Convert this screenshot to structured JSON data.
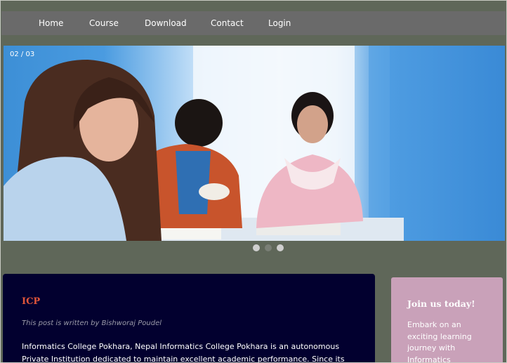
{
  "nav": {
    "items": [
      {
        "label": "Home"
      },
      {
        "label": "Course"
      },
      {
        "label": "Download"
      },
      {
        "label": "Contact"
      },
      {
        "label": "Login"
      }
    ]
  },
  "slider": {
    "counter": "02 / 03",
    "total_slides": 3,
    "active_slide": 2
  },
  "post": {
    "title": "ICP",
    "author": "This post is written by Bishworaj Poudel",
    "body": "Informatics College Pokhara, Nepal Informatics College Pokhara is an autonomous Private Institution dedicated to maintain excellent academic performance. Since its"
  },
  "join": {
    "title": "Join us today!",
    "text": "Embark on an exciting learning journey with Informatics"
  },
  "colors": {
    "background": "#5f6759",
    "nav_bar": "#6a6a6a",
    "post_bg": "#02002f",
    "post_title": "#e0553a",
    "join_bg": "#c9a1b9"
  }
}
